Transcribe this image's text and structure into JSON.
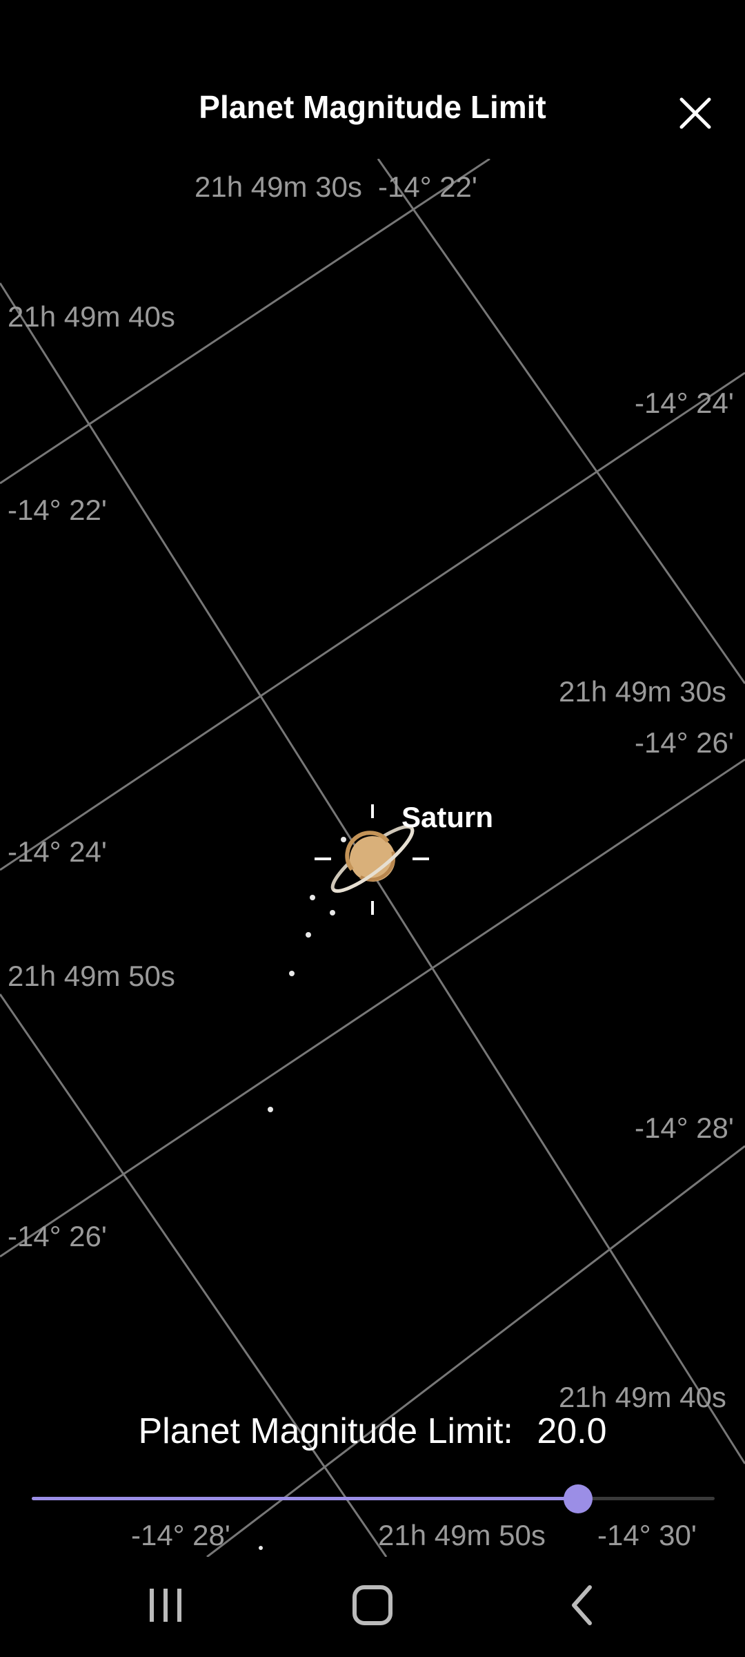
{
  "header": {
    "title": "Planet Magnitude Limit",
    "close_icon": "close-icon"
  },
  "sky": {
    "coords": [
      "21h 49m 30s",
      "-14° 22'",
      "21h 49m 40s",
      "-14° 24'",
      "-14° 22'",
      "21h 49m 30s",
      "-14° 26'",
      "-14° 24'",
      "21h 49m 50s",
      "-14° 28'",
      "-14° 26'",
      "21h 49m 40s",
      "-14° 28'",
      "21h 49m 50s",
      "-14° 30'"
    ],
    "planet_label": "Saturn",
    "colors": {
      "grid": "#8c8c8c",
      "label": "#9a9a9a",
      "planet": "#d9b07a"
    }
  },
  "magnitude": {
    "label": "Planet Magnitude Limit:",
    "value": "20.0",
    "slider_fraction": 0.8,
    "accent_color": "#9b8ee6"
  },
  "navbar": {
    "recent_icon": "recent-apps-icon",
    "home_icon": "home-icon",
    "back_icon": "back-icon"
  }
}
